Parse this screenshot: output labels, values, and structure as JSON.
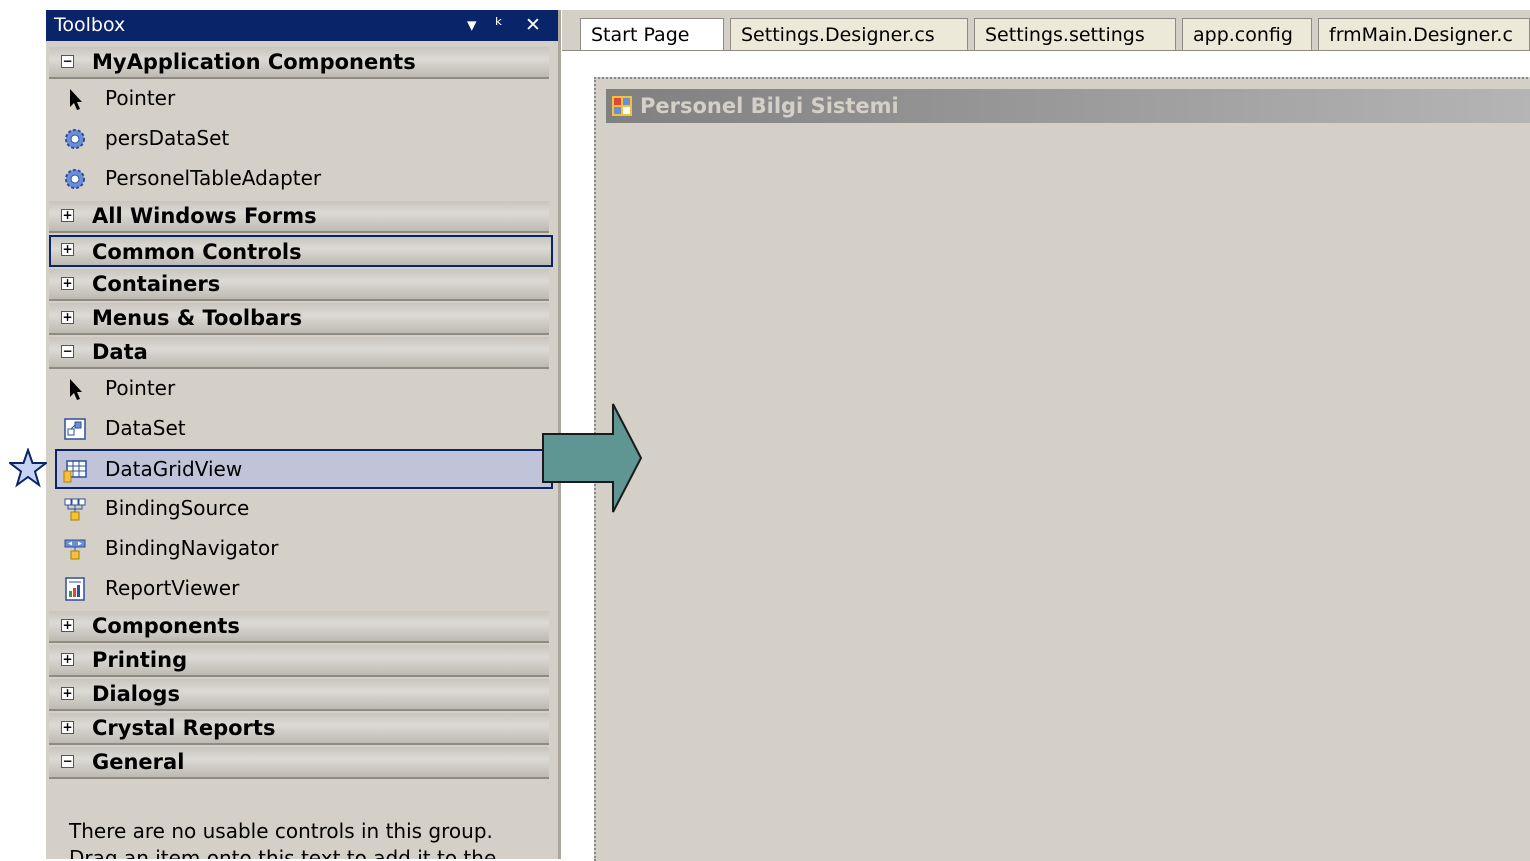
{
  "toolbox": {
    "title": "Toolbox",
    "controls": {
      "dropdown": "▾",
      "pin": "ᵖ",
      "close": "✕"
    },
    "groups": [
      {
        "label": "MyApplication Components",
        "expanded": true
      },
      {
        "label": "All Windows Forms",
        "expanded": false
      },
      {
        "label": "Common Controls",
        "expanded": false
      },
      {
        "label": "Containers",
        "expanded": false
      },
      {
        "label": "Menus & Toolbars",
        "expanded": false
      },
      {
        "label": "Data",
        "expanded": true
      },
      {
        "label": "Components",
        "expanded": false
      },
      {
        "label": "Printing",
        "expanded": false
      },
      {
        "label": "Dialogs",
        "expanded": false
      },
      {
        "label": "Crystal Reports",
        "expanded": false
      },
      {
        "label": "General",
        "expanded": true
      }
    ],
    "myapp_items": [
      {
        "label": "Pointer",
        "icon": "pointer-icon"
      },
      {
        "label": "persDataSet",
        "icon": "component-gear-icon"
      },
      {
        "label": "PersonelTableAdapter",
        "icon": "component-gear-icon"
      }
    ],
    "data_items": [
      {
        "label": "Pointer",
        "icon": "pointer-icon"
      },
      {
        "label": "DataSet",
        "icon": "dataset-icon"
      },
      {
        "label": "DataGridView",
        "icon": "datagridview-icon"
      },
      {
        "label": "BindingSource",
        "icon": "bindingsource-icon"
      },
      {
        "label": "BindingNavigator",
        "icon": "bindingnavigator-icon"
      },
      {
        "label": "ReportViewer",
        "icon": "reportviewer-icon"
      }
    ],
    "general_message": "There are no usable controls in this group. Drag an item onto this text to add it to the toolbox."
  },
  "tabs": [
    "Start Page",
    "Settings.Designer.cs",
    "Settings.settings",
    "app.config",
    "frmMain.Designer.c"
  ],
  "form": {
    "title": "Personel Bilgi Sistemi"
  },
  "colors": {
    "selection": "#c1c3d8",
    "titlebar": "#0a246a",
    "arrow_fill": "#5f9693",
    "star_fill": "#c7d3f2"
  }
}
